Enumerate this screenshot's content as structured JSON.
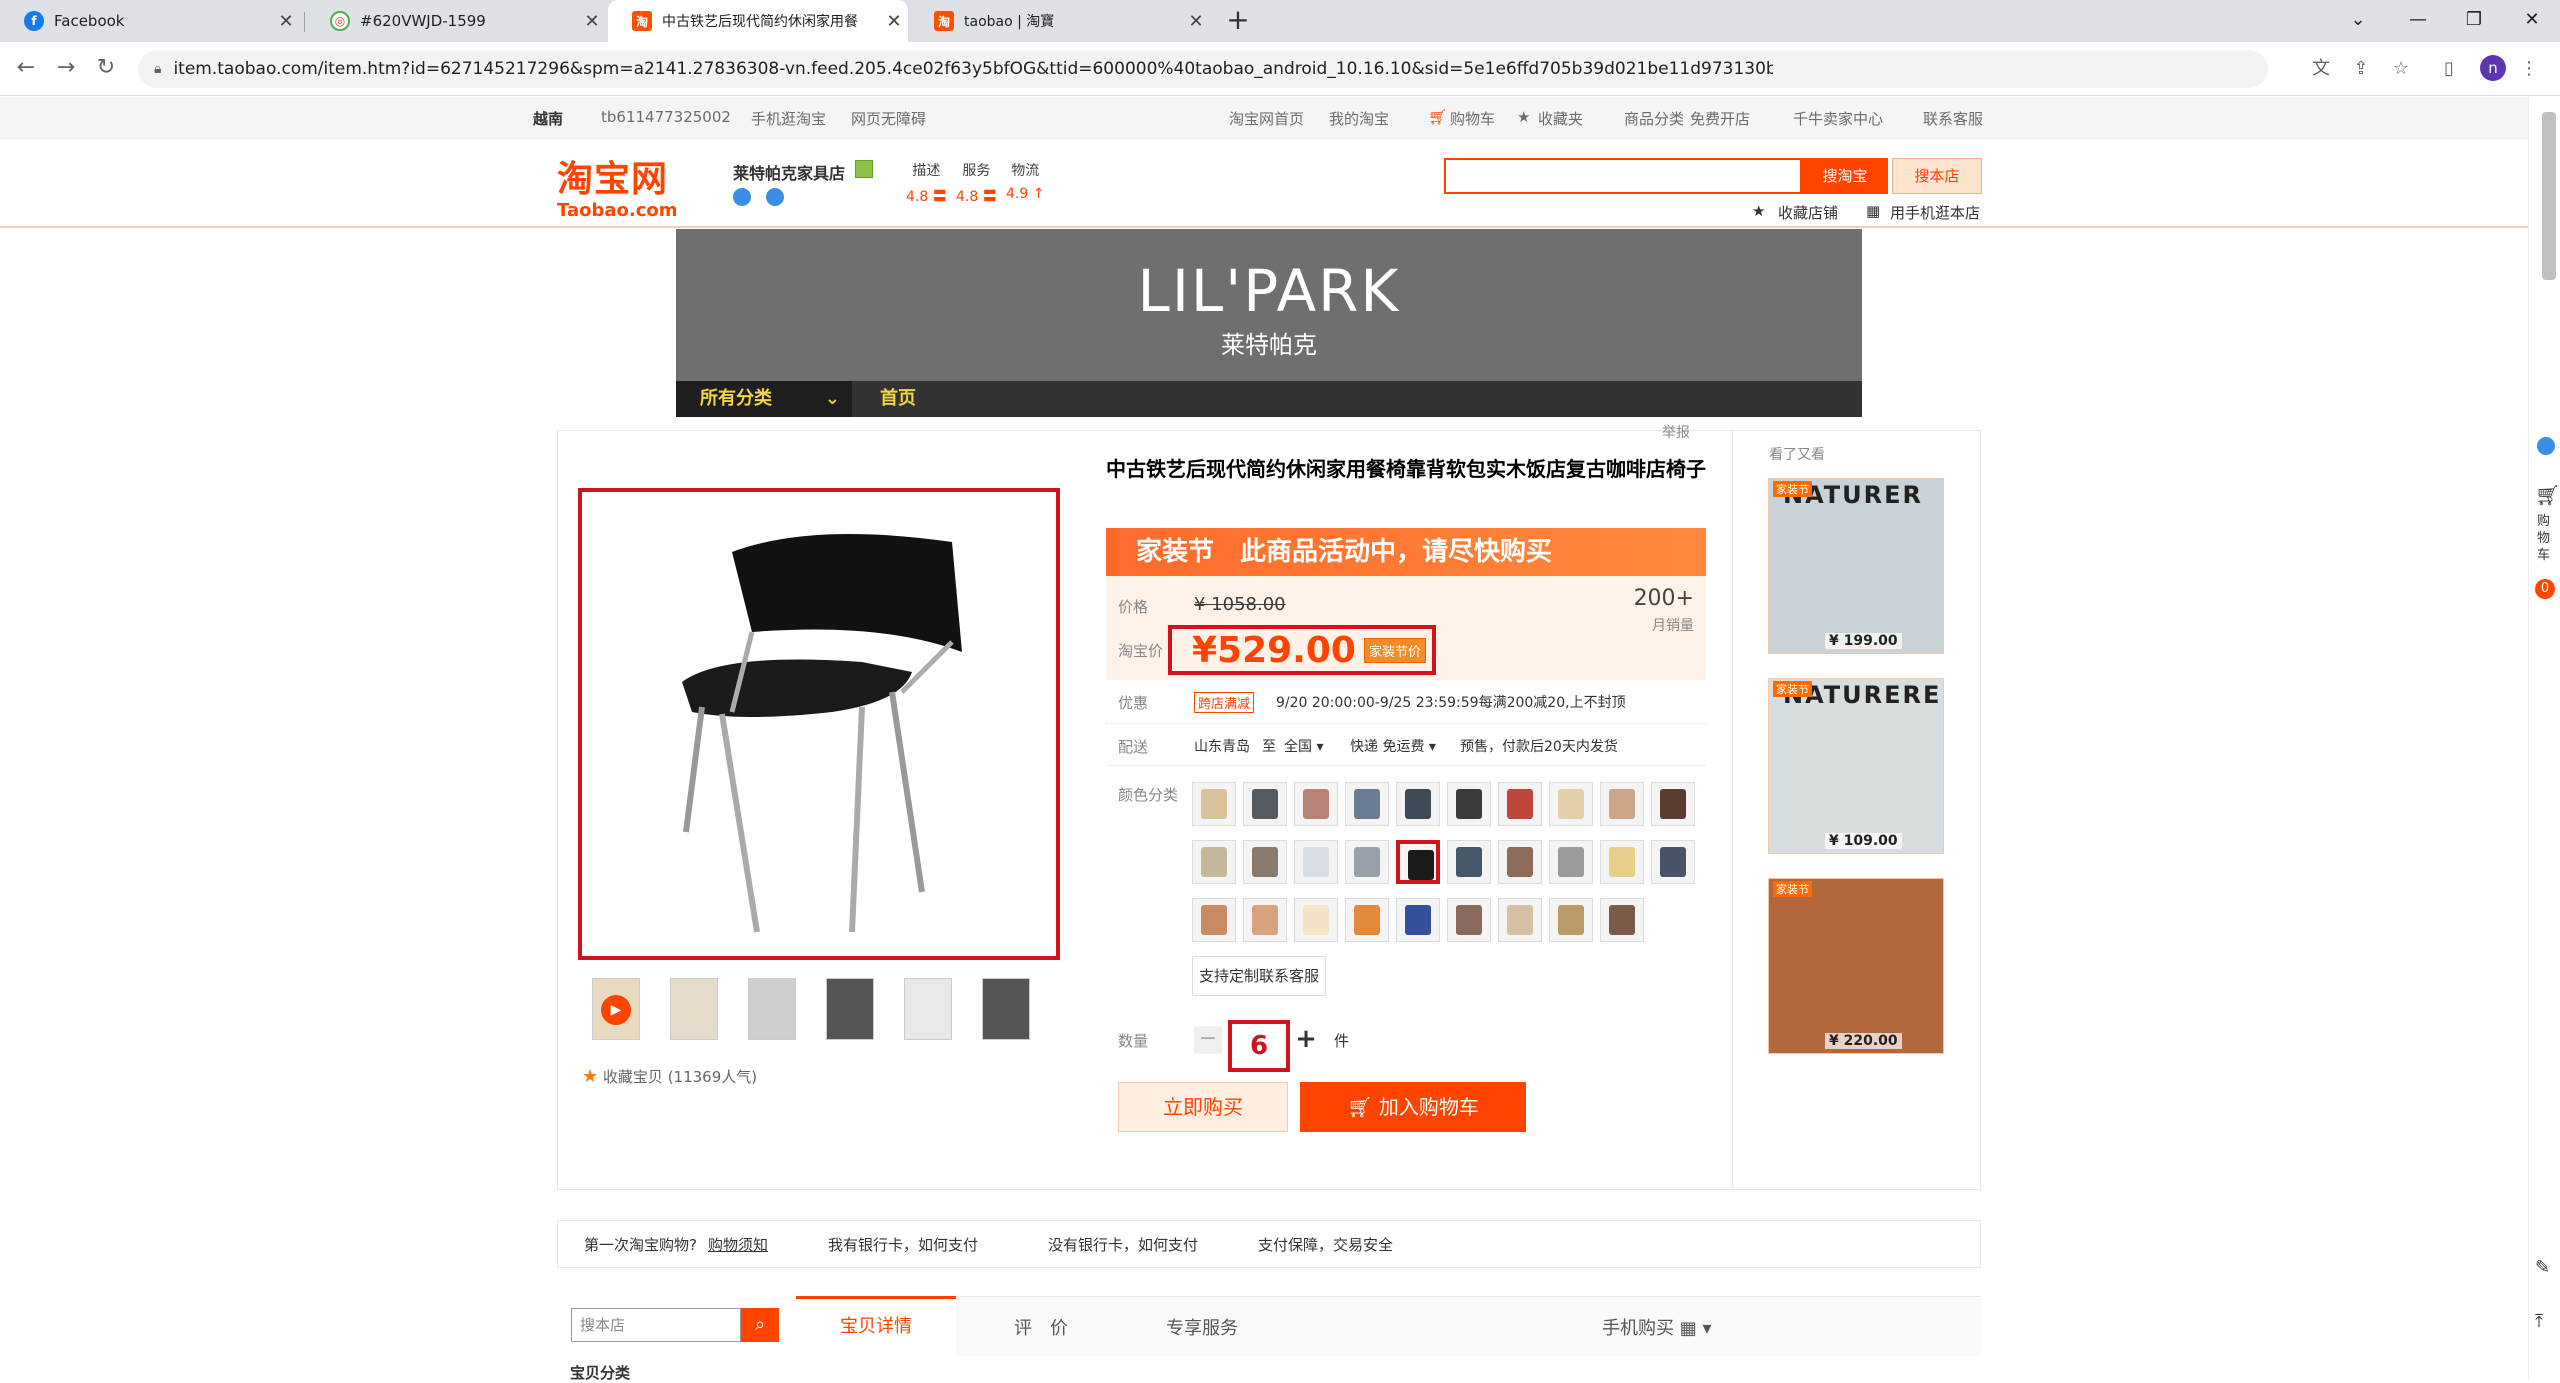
{
  "tabs": [
    {
      "title": "Facebook",
      "icon": "facebook-icon",
      "color": "#1877f2",
      "glyph": "f"
    },
    {
      "title": "#620VWJD-1599",
      "icon": "web-icon",
      "color": "#4caf50",
      "glyph": "◎"
    },
    {
      "title": "中古铁艺后现代简约休闲家用餐",
      "icon": "taobao-icon",
      "color": "#ff5000",
      "glyph": "淘"
    },
    {
      "title": "taobao | 淘寶",
      "icon": "taobao-icon",
      "color": "#ff5000",
      "glyph": "淘"
    }
  ],
  "url": "item.taobao.com/item.htm?id=627145217296&spm=a2141.27836308-vn.feed.205.4ce02f63y5bfOG&ttid=600000%40taobao_android_10.16.10&sid=5e1e6ffd705b39d021be11d973130b2b",
  "profile_initial": "n",
  "sitenav": {
    "region": "越南",
    "user": "tb611477325002",
    "mobile": "手机逛淘宝",
    "accessible": "网页无障碍",
    "home": "淘宝网首页",
    "mytaobao": "我的淘宝",
    "cart": "购物车",
    "favorites": "收藏夹",
    "categories": "商品分类",
    "openshop": "免费开店",
    "seller": "千牛卖家中心",
    "service": "联系客服"
  },
  "header": {
    "logo_cn": "淘宝网",
    "logo_en": "Taobao.com",
    "shop_name": "莱特帕克家具店",
    "ratings": [
      {
        "label": "描述",
        "value": "4.8",
        "trend": "〓"
      },
      {
        "label": "服务",
        "value": "4.8",
        "trend": "〓"
      },
      {
        "label": "物流",
        "value": "4.9",
        "trend": "↑"
      }
    ],
    "search_taobao": "搜淘宝",
    "search_shop": "搜本店",
    "fav_shop": "收藏店铺",
    "mobile_shop": "用手机逛本店"
  },
  "banner": {
    "brand": "LIL'PARK",
    "brand_cn": "莱特帕克",
    "nav_all": "所有分类",
    "nav_home": "首页"
  },
  "product": {
    "report": "举报",
    "title": "中古铁艺后现代简约休闲家用餐椅靠背软包实木饭店复古咖啡店椅子",
    "promo_banner": "家装节　此商品活动中，请尽快购买",
    "price_label": "价格",
    "old_price": "¥ 1058.00",
    "taobao_price_label": "淘宝价",
    "price": "¥529.00",
    "price_tag": "家装节价",
    "sales_count": "200+",
    "sales_label": "月销量",
    "promo_label": "优惠",
    "promo_badge": "跨店满减",
    "promo_text": "9/20 20:00:00-9/25 23:59:59每满200减20,上不封顶",
    "ship_label": "配送",
    "ship_from": "山东青岛",
    "ship_to_label": "至",
    "ship_to": "全国",
    "ship_method": "快递 免运费",
    "ship_note": "预售，付款后20天内发货",
    "color_label": "颜色分类",
    "custom_btn": "支持定制联系客服",
    "qty_label": "数量",
    "qty": "6",
    "qty_unit": "件",
    "buy_now": "立即购买",
    "add_cart": "加入购物车",
    "fav_item": "收藏宝贝 (11369人气)"
  },
  "swatch_colors": [
    "#d8c39a",
    "#555a60",
    "#b88272",
    "#6b7d95",
    "#3e4a55",
    "#3a3a3a",
    "#c0453a",
    "#e2cfa8",
    "#caa58a",
    "#5a3b2e",
    "#c7b89c",
    "#8a7b6c",
    "#d9dde4",
    "#9aa0a8",
    "#1a1a1a",
    "#44576b",
    "#8d6b58",
    "#9b9b9b",
    "#e7cf8a",
    "#4a5468",
    "#c98a64",
    "#d7a27d",
    "#f2e4c4",
    "#e48a3a",
    "#33509a",
    "#8a6a5a",
    "#d6c0a4",
    "#b99c6a",
    "#7a5a48"
  ],
  "rail": {
    "head": "看了又看",
    "items": [
      {
        "badge": "家装节",
        "brand": "NATURER",
        "price": "¥ 199.00",
        "bg": "#c9d2d6"
      },
      {
        "badge": "家装节",
        "brand": "NATURERE",
        "price": "¥ 109.00",
        "bg": "#d8dde0"
      },
      {
        "badge": "家装节",
        "brand": "",
        "price": "¥ 220.00",
        "bg": "#b3673c"
      }
    ]
  },
  "info": {
    "first_time": "第一次淘宝购物?",
    "first_link": "购物须知",
    "have_card": "我有银行卡，如何支付",
    "no_card": "没有银行卡，如何支付",
    "guarantee": "支付保障，交易安全"
  },
  "bottom": {
    "shop_search_placeholder": "搜本店",
    "tab_detail": "宝贝详情",
    "tab_review": "评　价",
    "tab_service": "专享服务",
    "tab_mobile": "手机购买",
    "category": "宝贝分类"
  },
  "sidepanel": {
    "cart": "购物车",
    "cart_count": "0"
  },
  "accent": "#ff4400",
  "highlight": "#d3121f"
}
